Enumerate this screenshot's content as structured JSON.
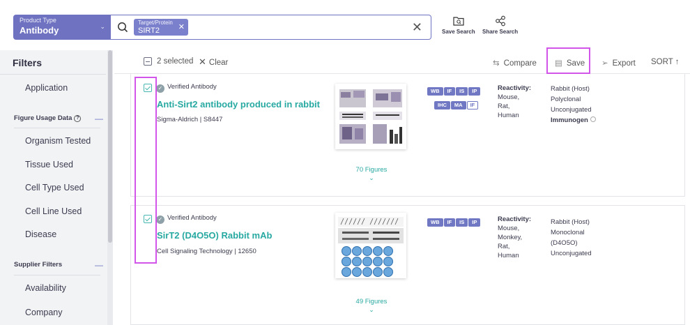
{
  "search": {
    "product_type_label": "Product Type",
    "product_type_value": "Antibody",
    "chip_label": "Target/Protein",
    "chip_value": "SIRT2",
    "save_search": "Save Search",
    "share_search": "Share Search"
  },
  "sidebar": {
    "title": "Filters",
    "application": "Application",
    "figure_usage": "Figure Usage Data",
    "organism": "Organism Tested",
    "tissue": "Tissue Used",
    "cell_type": "Cell Type Used",
    "cell_line": "Cell Line Used",
    "disease": "Disease",
    "supplier_filters": "Supplier Filters",
    "availability": "Availability",
    "company": "Company"
  },
  "results_header": {
    "selected": "2 selected",
    "clear": "Clear",
    "compare": "Compare",
    "save": "Save",
    "export": "Export",
    "sort": "SORT ↑"
  },
  "results": [
    {
      "verified": "Verified Antibody",
      "title": "Anti-Sirt2 antibody produced in rabbit",
      "supplier": "Sigma-Aldrich | S8447",
      "figures": "70 Figures",
      "tags_row1": [
        "WB",
        "IF",
        "IS",
        "IP"
      ],
      "tags_row2": [
        "IHC",
        "MA",
        "IF"
      ],
      "reactivity_label": "Reactivity:",
      "reactivity": [
        "Mouse,",
        "Rat,",
        "Human"
      ],
      "props": [
        "Rabbit (Host)",
        "Polyclonal",
        "Unconjugated"
      ],
      "immunogen": "Immunogen"
    },
    {
      "verified": "Verified Antibody",
      "title": "SirT2 (D4O5O) Rabbit mAb",
      "supplier": "Cell Signaling Technology | 12650",
      "figures": "49 Figures",
      "tags_row1": [
        "WB",
        "IF",
        "IS",
        "IP"
      ],
      "reactivity_label": "Reactivity:",
      "reactivity": [
        "Mouse,",
        "Monkey,",
        "Rat,",
        "Human"
      ],
      "props": [
        "Rabbit (Host)",
        "Monoclonal",
        "(D4O5O)",
        "Unconjugated"
      ]
    }
  ],
  "colors": {
    "accent": "#6e72c1",
    "teal": "#27a9a1",
    "highlight": "#d155e8"
  }
}
